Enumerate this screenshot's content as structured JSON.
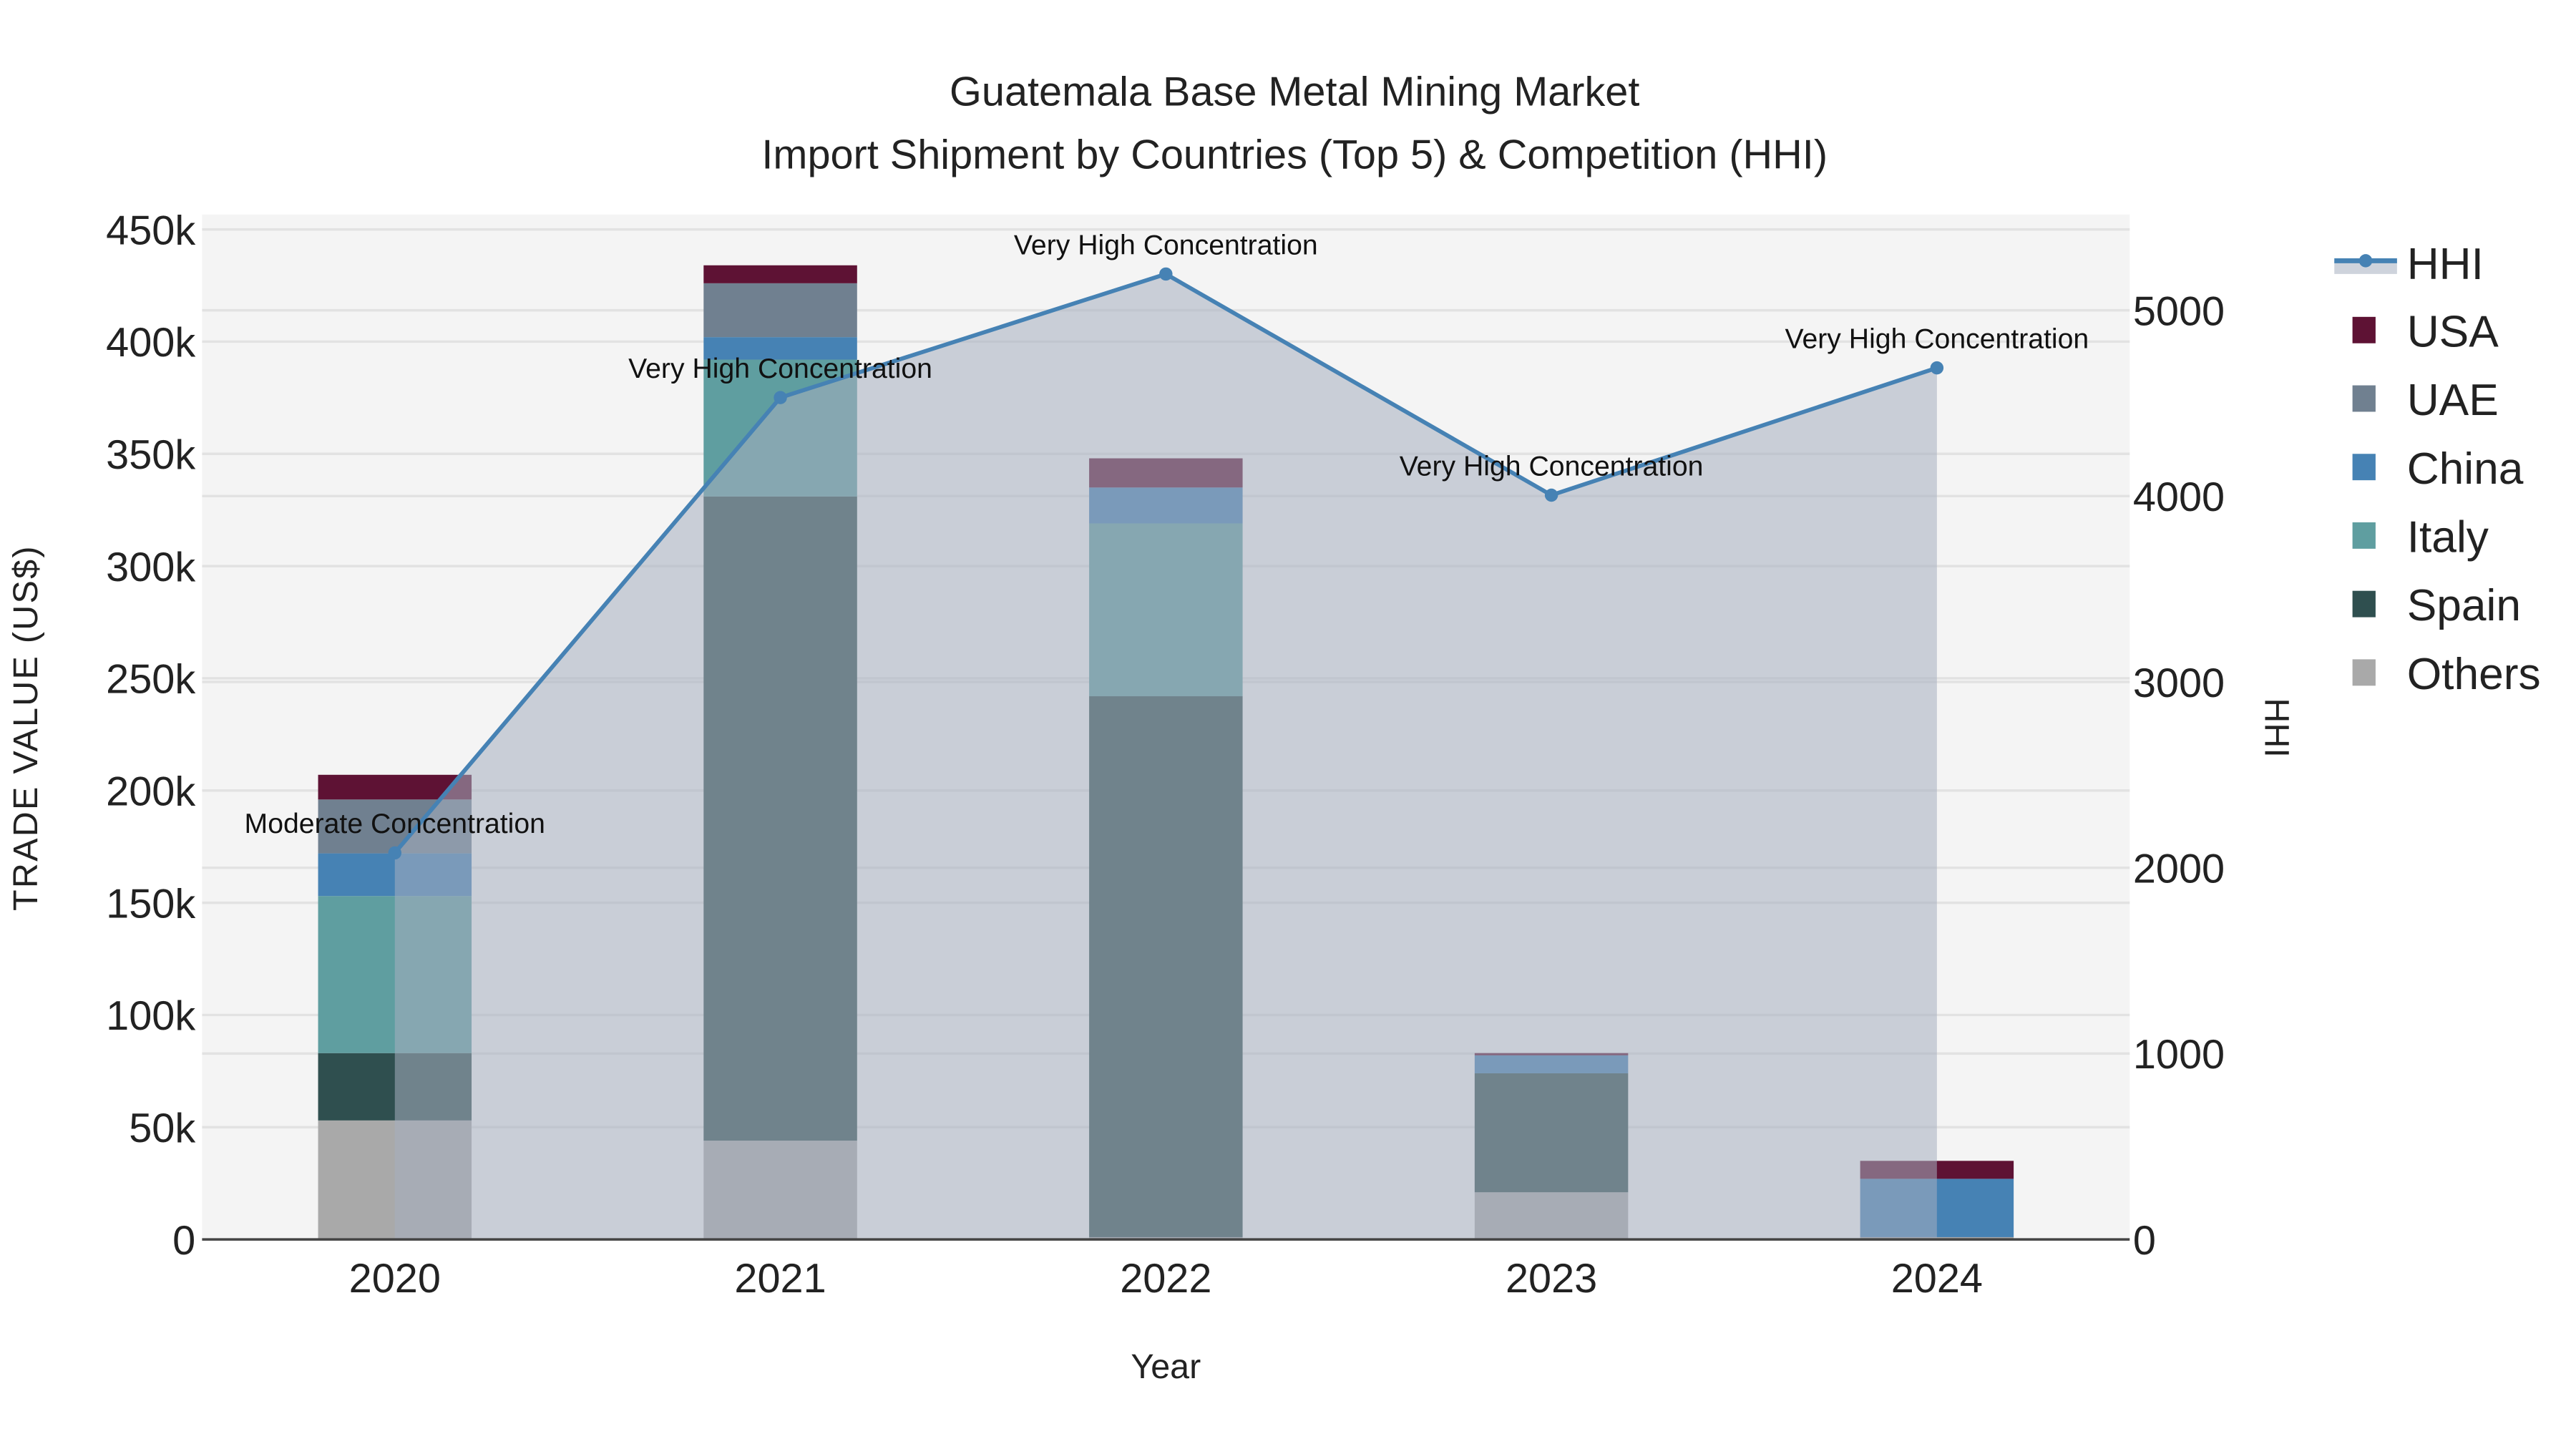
{
  "chart_data": {
    "type": "bar",
    "stacked": true,
    "title": "Guatemala Base Metal Mining Market",
    "subtitle": "Import Shipment by Countries (Top 5) & Competition (HHI)",
    "xlabel": "Year",
    "ylabel": "TRADE VALUE (US$)",
    "y2label": "HHI",
    "categories": [
      "2020",
      "2021",
      "2022",
      "2023",
      "2024"
    ],
    "ylim": [
      0,
      450000
    ],
    "yticks": [
      0,
      50000,
      100000,
      150000,
      200000,
      250000,
      300000,
      350000,
      400000,
      450000
    ],
    "ytick_labels": [
      "0",
      "50k",
      "100k",
      "150k",
      "200k",
      "250k",
      "300k",
      "350k",
      "400k",
      "450k"
    ],
    "y2lim": [
      0,
      5450
    ],
    "y2ticks": [
      0,
      1000,
      2000,
      3000,
      4000,
      5000
    ],
    "y2tick_labels": [
      "0",
      "1000",
      "2000",
      "3000",
      "4000",
      "5000"
    ],
    "series": [
      {
        "name": "Others",
        "color": "#a9a9a9",
        "values": [
          53000,
          44000,
          1000,
          21000,
          1000
        ]
      },
      {
        "name": "Spain",
        "color": "#2f4f4f",
        "values": [
          30000,
          287000,
          241000,
          53000,
          0
        ]
      },
      {
        "name": "Italy",
        "color": "#5f9ea0",
        "values": [
          70000,
          61000,
          77000,
          0,
          0
        ]
      },
      {
        "name": "China",
        "color": "#4682b4",
        "values": [
          19000,
          10000,
          16000,
          8000,
          26000
        ]
      },
      {
        "name": "UAE",
        "color": "#708090",
        "values": [
          24000,
          24000,
          0,
          0,
          0
        ]
      },
      {
        "name": "USA",
        "color": "#5e1234",
        "values": [
          11000,
          8000,
          13000,
          1000,
          8000
        ]
      }
    ],
    "line": {
      "name": "HHI",
      "color": "#4682b4",
      "values": [
        2080,
        4530,
        5195,
        4005,
        4690
      ],
      "annotations": [
        "Moderate Concentration",
        "Very High Concentration",
        "Very High Concentration",
        "Very High Concentration",
        "Very High Concentration"
      ]
    },
    "legend": {
      "placement": "right",
      "entries": [
        "HHI",
        "USA",
        "UAE",
        "China",
        "Italy",
        "Spain",
        "Others"
      ]
    },
    "grid": true
  }
}
